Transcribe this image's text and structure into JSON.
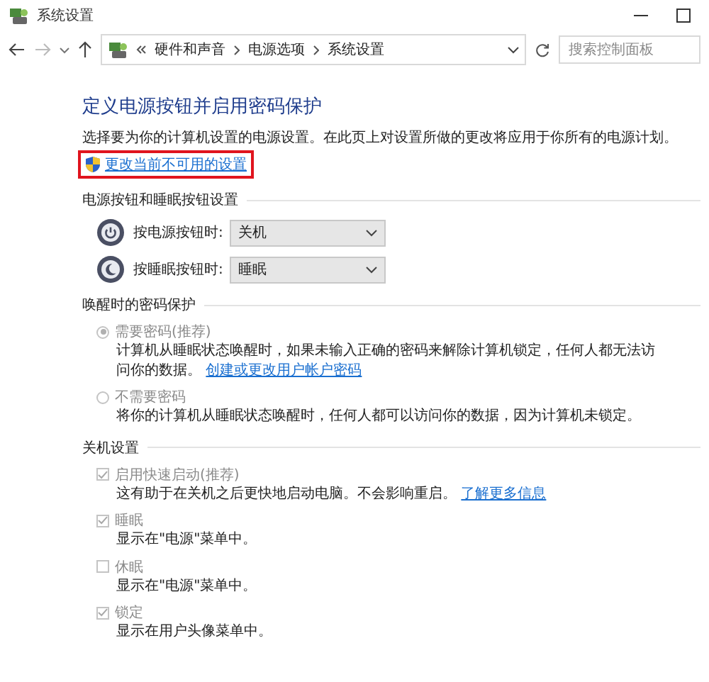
{
  "window": {
    "title": "系统设置"
  },
  "nav": {
    "crumbs": [
      "硬件和声音",
      "电源选项",
      "系统设置"
    ],
    "search": {
      "placeholder": "搜索控制面板"
    }
  },
  "heading": "定义电源按钮并启用密码保护",
  "description": "选择要为你的计算机设置的电源设置。在此页上对设置所做的更改将应用于你所有的电源计划。",
  "admin_link": {
    "label": "更改当前不可用的设置",
    "highlighted": true
  },
  "sections": [
    {
      "kind": "dropdowns",
      "title": "电源按钮和睡眠按钮设置",
      "rows": [
        {
          "label": "按电源按钮时:",
          "value": "关机"
        },
        {
          "label": "按睡眠按钮时:",
          "value": "睡眠"
        }
      ]
    },
    {
      "kind": "radios",
      "title": "唤醒时的密码保护",
      "options": [
        {
          "label": "需要密码(推荐)",
          "selected": true,
          "disabled": true,
          "description": "计算机从睡眠状态唤醒时，如果未输入正确的密码来解除计算机锁定，任何人都无法访问你的数据。",
          "link": "创建或更改用户帐户密码"
        },
        {
          "label": "不需要密码",
          "selected": false,
          "disabled": true,
          "description": "将你的计算机从睡眠状态唤醒时，任何人都可以访问你的数据，因为计算机未锁定。"
        }
      ]
    },
    {
      "kind": "checkboxes",
      "title": "关机设置",
      "options": [
        {
          "label": "启用快速启动(推荐)",
          "checked": true,
          "disabled": true,
          "description": "这有助于在关机之后更快地启动电脑。不会影响重启。",
          "link": "了解更多信息"
        },
        {
          "label": "睡眠",
          "checked": true,
          "disabled": true,
          "description": "显示在\"电源\"菜单中。"
        },
        {
          "label": "休眠",
          "checked": false,
          "disabled": true,
          "description": "显示在\"电源\"菜单中。"
        },
        {
          "label": "锁定",
          "checked": true,
          "disabled": true,
          "description": "显示在用户头像菜单中。"
        }
      ]
    }
  ]
}
